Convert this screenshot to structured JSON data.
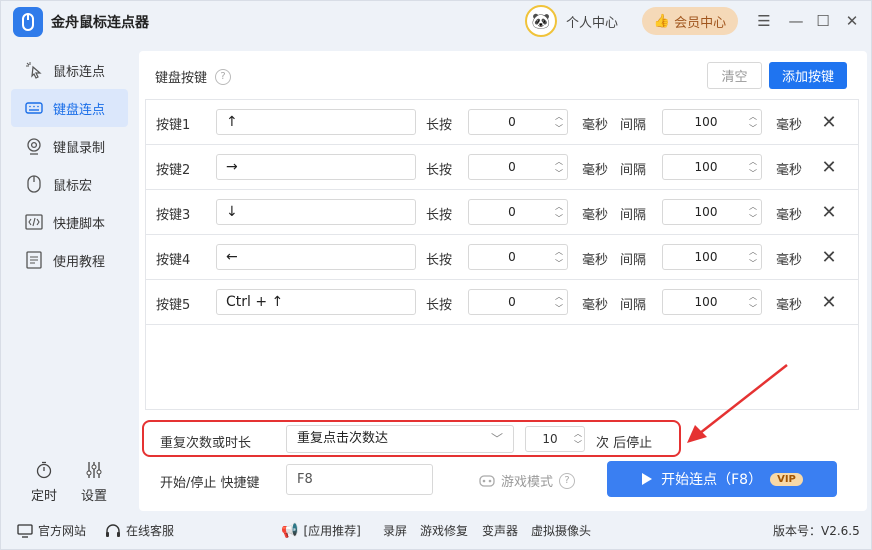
{
  "app": {
    "title": "金舟鼠标连点器"
  },
  "header": {
    "personal_center": "个人中心",
    "member_center": "会员中心"
  },
  "sidebar": {
    "items": [
      {
        "label": "鼠标连点",
        "icon": "cursor-click-icon"
      },
      {
        "label": "键盘连点",
        "icon": "keyboard-icon"
      },
      {
        "label": "键鼠录制",
        "icon": "webcam-icon"
      },
      {
        "label": "鼠标宏",
        "icon": "mouse-icon"
      },
      {
        "label": "快捷脚本",
        "icon": "code-icon"
      },
      {
        "label": "使用教程",
        "icon": "document-icon"
      }
    ],
    "timer_label": "定时",
    "settings_label": "设置"
  },
  "panel": {
    "title": "键盘按键",
    "clear_label": "清空",
    "add_label": "添加按键",
    "col_long_press": "长按",
    "col_ms": "毫秒",
    "col_interval": "间隔",
    "rows": [
      {
        "name": "按键1",
        "key": "↑",
        "long_press": "0",
        "interval": "100"
      },
      {
        "name": "按键2",
        "key": "→",
        "long_press": "0",
        "interval": "100"
      },
      {
        "name": "按键3",
        "key": "↓",
        "long_press": "0",
        "interval": "100"
      },
      {
        "name": "按键4",
        "key": "←",
        "long_press": "0",
        "interval": "100"
      },
      {
        "name": "按键5",
        "key": "Ctrl + ↑",
        "long_press": "0",
        "interval": "100"
      }
    ]
  },
  "repeat": {
    "label": "重复次数或时长",
    "mode": "重复点击次数达",
    "count": "10",
    "suffix": "次 后停止"
  },
  "hotkey": {
    "label": "开始/停止 快捷键",
    "value": "F8"
  },
  "game_mode": {
    "label": "游戏模式"
  },
  "start": {
    "label": "开始连点（F8）",
    "badge": "VIP"
  },
  "footer": {
    "website": "官方网站",
    "service": "在线客服",
    "recommend": "[应用推荐]",
    "links": [
      "录屏",
      "游戏修复",
      "变声器",
      "虚拟摄像头"
    ],
    "version": "版本号：V2.6.5"
  },
  "colors": {
    "accent": "#1f74f0",
    "highlight_border": "#e53232",
    "vip_bg": "#f8d9a7"
  }
}
